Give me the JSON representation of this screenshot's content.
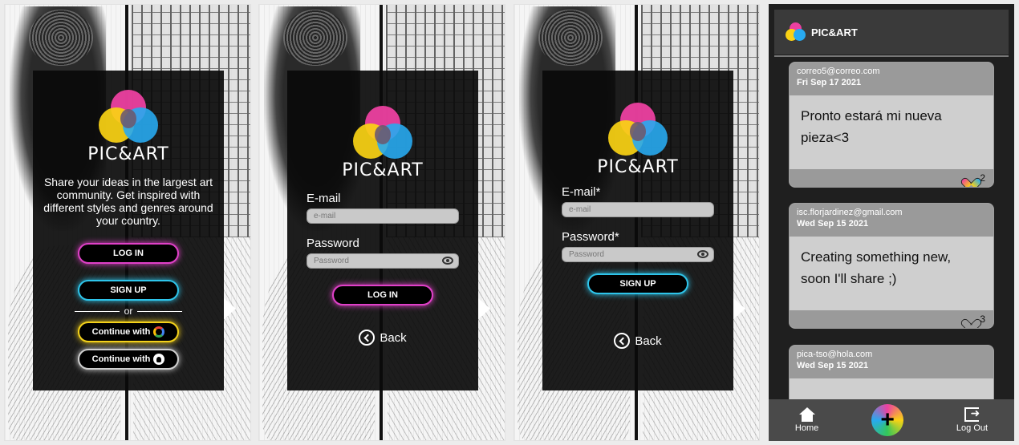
{
  "brand": {
    "name": "PIC&ART"
  },
  "welcome": {
    "tagline": "Share your ideas in the largest art community. Get inspired with different styles and genres around your country.",
    "login_label": "LOG IN",
    "signup_label": "SIGN UP",
    "or_label": "or",
    "google_label": "Continue with",
    "github_label": "Continue with"
  },
  "login": {
    "email_label": "E-mail",
    "email_placeholder": "e-mail",
    "password_label": "Password",
    "password_placeholder": "Password",
    "submit_label": "LOG IN",
    "back_label": "Back"
  },
  "signup": {
    "email_label": "E-mail*",
    "email_placeholder": "e-mail",
    "password_label": "Password*",
    "password_placeholder": "Password",
    "submit_label": "SIGN UP",
    "back_label": "Back"
  },
  "feed": {
    "title": "PIC&ART",
    "posts": [
      {
        "email": "correo5@correo.com",
        "date": "Fri Sep 17 2021",
        "text": "Pronto estará mi nueva pieza<3",
        "likes": "2",
        "liked": true
      },
      {
        "email": "isc.florjardinez@gmail.com",
        "date": "Wed Sep 15 2021",
        "text": "Creating something new, soon I'll share ;)",
        "likes": "3",
        "liked": false
      },
      {
        "email": "pica-tso@hola.com",
        "date": "Wed Sep 15 2021",
        "text": "",
        "likes": "",
        "liked": false
      }
    ],
    "nav": {
      "home_label": "Home",
      "logout_label": "Log Out",
      "add_icon": "+"
    }
  },
  "colors": {
    "magenta": "#e040c8",
    "cyan": "#2ec4ea",
    "yellow": "#f4d11a",
    "card": "#0a0a0a",
    "feed_bg": "#1f1f1f"
  }
}
